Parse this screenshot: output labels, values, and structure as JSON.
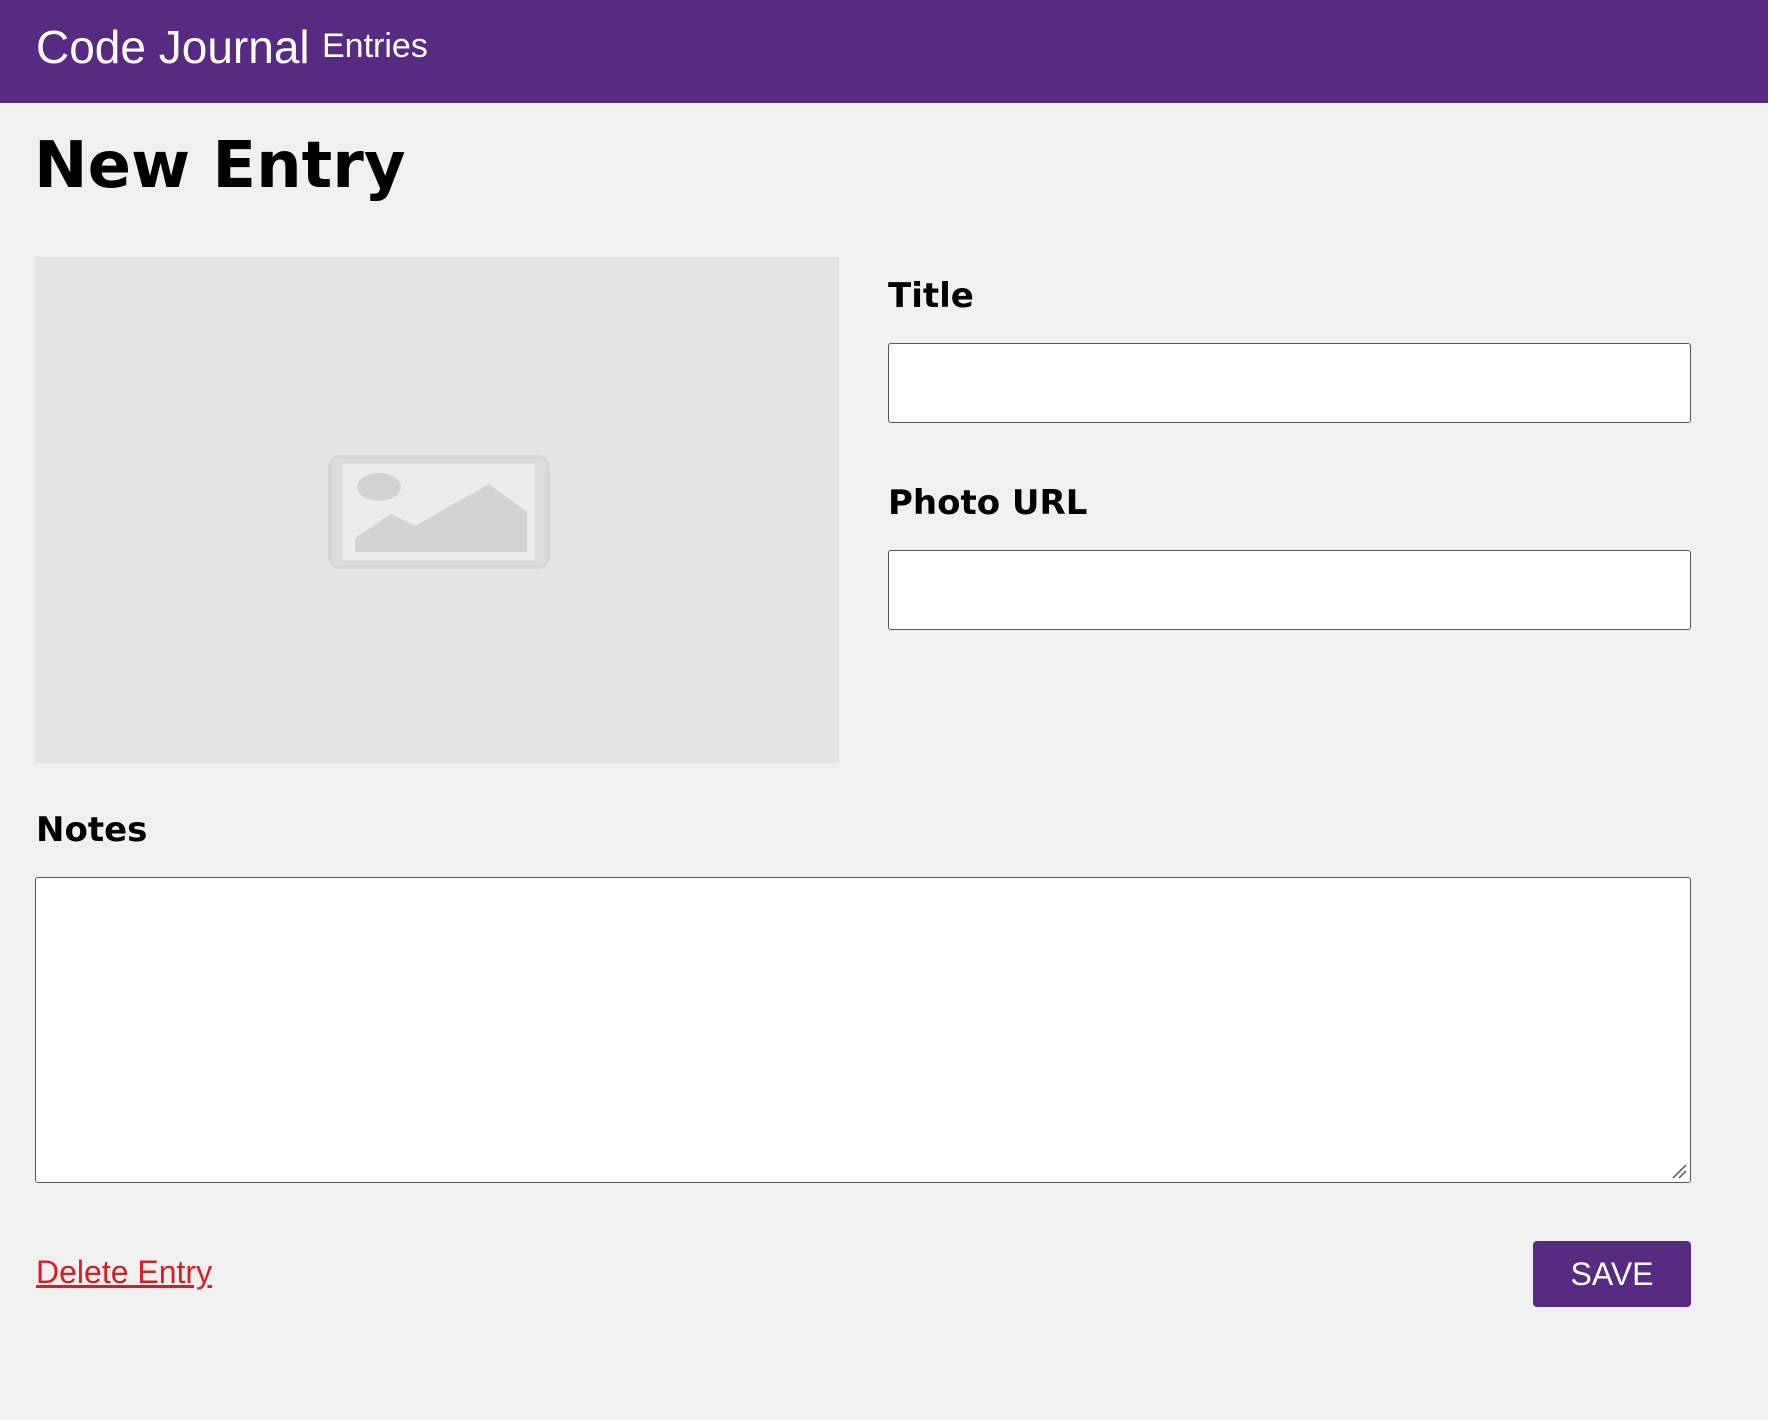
{
  "header": {
    "brand": "Code Journal",
    "nav_entries": "Entries",
    "background_color": "#572b82"
  },
  "page": {
    "title": "New Entry"
  },
  "photo_preview": {
    "icon": "image-placeholder-icon"
  },
  "form": {
    "title_label": "Title",
    "title_value": "",
    "photo_url_label": "Photo URL",
    "photo_url_value": "",
    "notes_label": "Notes",
    "notes_value": ""
  },
  "actions": {
    "delete_label": "Delete Entry",
    "delete_color": "#d51e26",
    "save_label": "SAVE"
  }
}
